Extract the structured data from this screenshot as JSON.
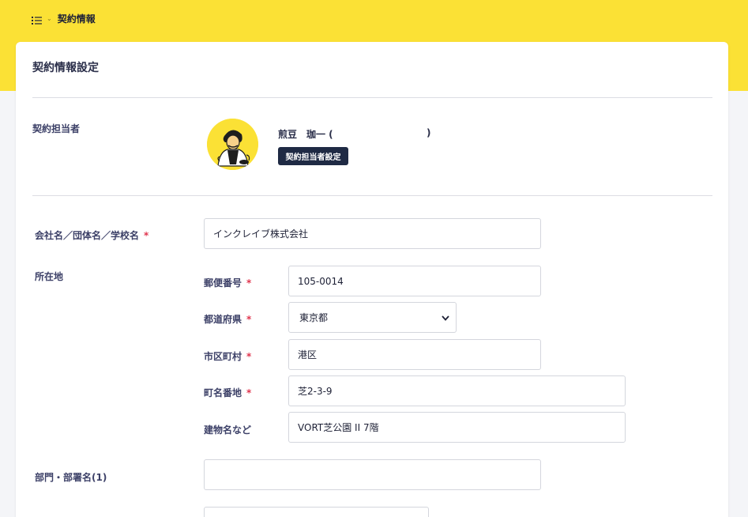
{
  "breadcrumb": {
    "menu_icon": "list-icon",
    "title": "契約情報"
  },
  "card": {
    "title": "契約情報設定"
  },
  "owner": {
    "label": "契約担当者",
    "name": "煎豆　珈一 (",
    "name_close": ")",
    "button_label": "契約担当者設定",
    "avatar_icon": "person-avatar-icon"
  },
  "company": {
    "label": "会社名／団体名／学校名",
    "required_mark": "*",
    "value": "インクレイブ株式会社"
  },
  "address": {
    "label": "所在地",
    "postal": {
      "label": "郵便番号",
      "required_mark": "*",
      "value": "105-0014"
    },
    "prefecture": {
      "label": "都道府県",
      "required_mark": "*",
      "value": "東京都"
    },
    "city": {
      "label": "市区町村",
      "required_mark": "*",
      "value": "港区"
    },
    "street": {
      "label": "町名番地",
      "required_mark": "*",
      "value": "芝2-3-9"
    },
    "building": {
      "label": "建物名など",
      "value": "VORT芝公園 II 7階"
    }
  },
  "department": {
    "label": "部門・部署名(1)",
    "value": ""
  },
  "colors": {
    "accent_yellow": "#fbe135",
    "button_navy": "#1f2a44",
    "required_red": "#e0364f"
  }
}
